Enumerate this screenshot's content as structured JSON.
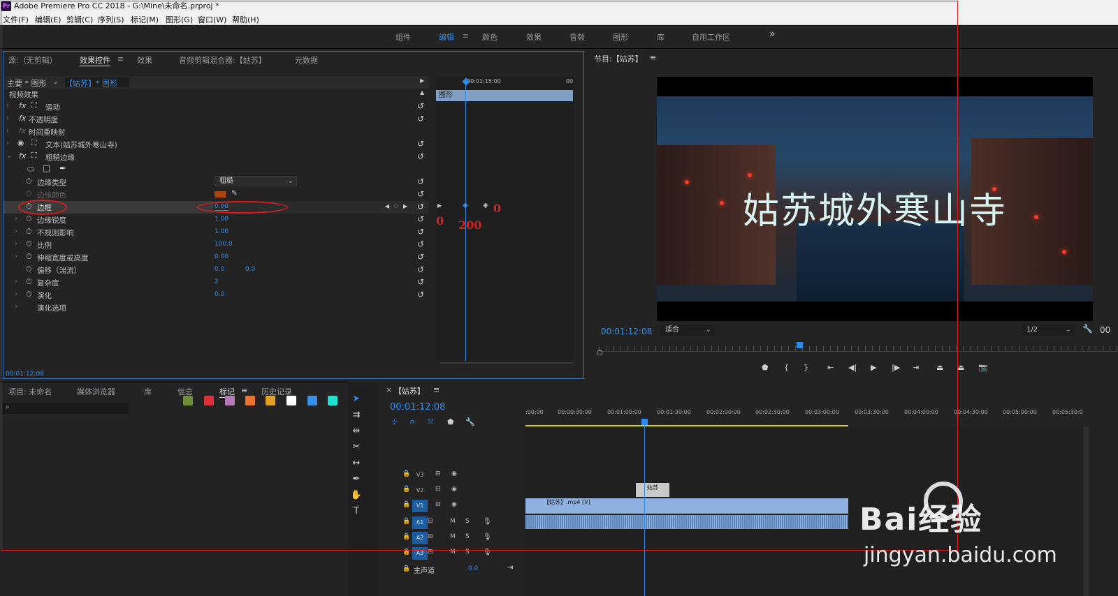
{
  "titlebar": {
    "title": "Adobe Premiere Pro CC 2018 - G:\\Mine\\未命名.prproj *",
    "logo": "Pr"
  },
  "menu": [
    "文件(F)",
    "编辑(E)",
    "剪辑(C)",
    "序列(S)",
    "标记(M)",
    "图形(G)",
    "窗口(W)",
    "帮助(H)"
  ],
  "workspaces": [
    "组件",
    "编辑",
    "颜色",
    "效果",
    "音频",
    "图形",
    "库",
    "自用工作区"
  ],
  "workspace_more": "»",
  "ws_menu": "≡",
  "source_tabs": {
    "source": "源:（无剪辑）",
    "effect_controls": "效果控件",
    "effects": "效果",
    "mixer": "音频剪辑混合器:【姑苏】",
    "metadata": "元数据",
    "menu": "≡"
  },
  "ec": {
    "master": "主要 * 图形",
    "clip": "【姑苏】* 图形",
    "section": "视频效果",
    "ruler_time": "00:01:15:00",
    "ruler_end": "00",
    "clip_bar": "图形",
    "controls": [
      {
        "label": "运动",
        "value": ""
      },
      {
        "label": "不透明度",
        "value": ""
      },
      {
        "label": "时间重映射",
        "value": ""
      },
      {
        "label": "文本(姑苏城外寒山寺)",
        "value": ""
      },
      {
        "label": "粗糙边缘",
        "value": ""
      },
      {
        "label": "边缘类型",
        "value": "粗糙"
      },
      {
        "label": "边缘颜色",
        "value": ""
      },
      {
        "label": "边框",
        "value": "0.00"
      },
      {
        "label": "边缘锐度",
        "value": "1.00"
      },
      {
        "label": "不规则影响",
        "value": "1.00"
      },
      {
        "label": "比例",
        "value": "100.0"
      },
      {
        "label": "伸缩宽度或高度",
        "value": "0.00"
      },
      {
        "label": "偏移（湍流）",
        "value": "0.0",
        "value2": "0.0"
      },
      {
        "label": "复杂度",
        "value": "2"
      },
      {
        "label": "演化",
        "value": "0.0"
      },
      {
        "label": "演化选项",
        "value": ""
      }
    ],
    "timecode": "00:01:12:08",
    "annot": {
      "a": "0",
      "b": "200",
      "c": "0"
    }
  },
  "program": {
    "title": "节目:【姑苏】",
    "menu": "≡",
    "overlay_text": "姑苏城外寒山寺",
    "timecode": "00:01:12:08",
    "fit": "适合",
    "res": "1/2",
    "right_tc": "00"
  },
  "project_tabs": {
    "project": "项目: 未命名",
    "media": "媒体浏览器",
    "library": "库",
    "info": "信息",
    "markers": "标记",
    "history": "历史记录",
    "menu": "≡"
  },
  "marker_colors": [
    "#6e8f3a",
    "#d9303a",
    "#b67ab8",
    "#e8752c",
    "#e0a226",
    "#ffffff",
    "#3a8fe6",
    "#20e0cf"
  ],
  "timeline": {
    "tab": "姑苏",
    "close": "×",
    "menu": "≡",
    "timecode": "00:01:12:08",
    "ruler": [
      ":00:00",
      "00:00:30:00",
      "00:01:00:00",
      "00:01:30:00",
      "00:02:00:00",
      "00:02:30:00",
      "00:03:00:00",
      "00:03:30:00",
      "00:04:00:00",
      "00:04:30:00",
      "00:05:00:00",
      "00:05:30:0"
    ],
    "tracks": [
      "V3",
      "V2",
      "V1",
      "A1",
      "A2",
      "A3"
    ],
    "master": "主声道",
    "master_val": "0.0",
    "m": "M",
    "s": "S",
    "clip_v2": "姑苏",
    "clip_v1": "【姑苏】.mp4 [V]"
  },
  "watermark": {
    "text": "Bai经验",
    "url": "jingyan.baidu.com"
  }
}
